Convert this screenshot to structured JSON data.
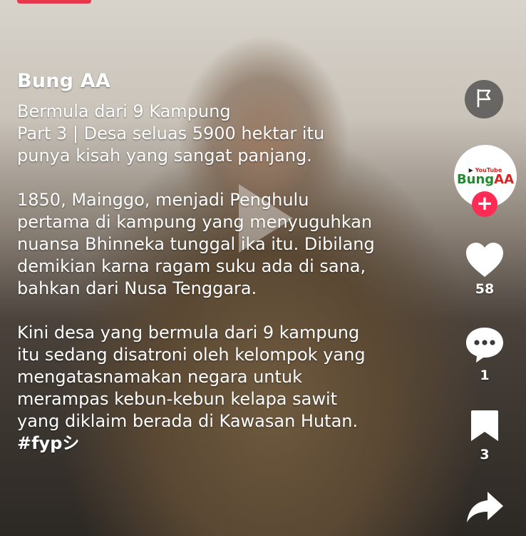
{
  "post": {
    "username": "Bung AA",
    "caption": "Bermula dari 9 Kampung\nPart 3 | Desa seluas 5900 hektar itu\npunya kisah yang sangat panjang.\n\n1850, Mainggo, menjadi Penghulu\npertama di kampung yang menyuguhkan\nnuansa Bhinneka tunggal ika itu. Dibilang\ndemikian karna ragam suku ada di sana,\nbahkan dari Nusa Tenggara.\n\nKini desa yang bermula dari 9 kampung\nitu sedang disatroni oleh kelompok yang\nmengatasnamakan negara untuk\nmerampas kebun-kebun kelapa sawit\nyang diklaim berada di Kawasan Hutan.",
    "hashtag": "#fypシ"
  },
  "avatar": {
    "youtube_label": "YouTube",
    "logo_text_green": "Bung",
    "logo_text_red": "AA"
  },
  "actions": {
    "likes": "58",
    "comments": "1",
    "saves": "3",
    "shares": ""
  },
  "colors": {
    "accent": "#fe2c55",
    "text": "#ffffff"
  },
  "icons": [
    "flag-icon",
    "plus-icon",
    "heart-icon",
    "comment-icon",
    "bookmark-icon",
    "share-icon",
    "play-icon"
  ]
}
